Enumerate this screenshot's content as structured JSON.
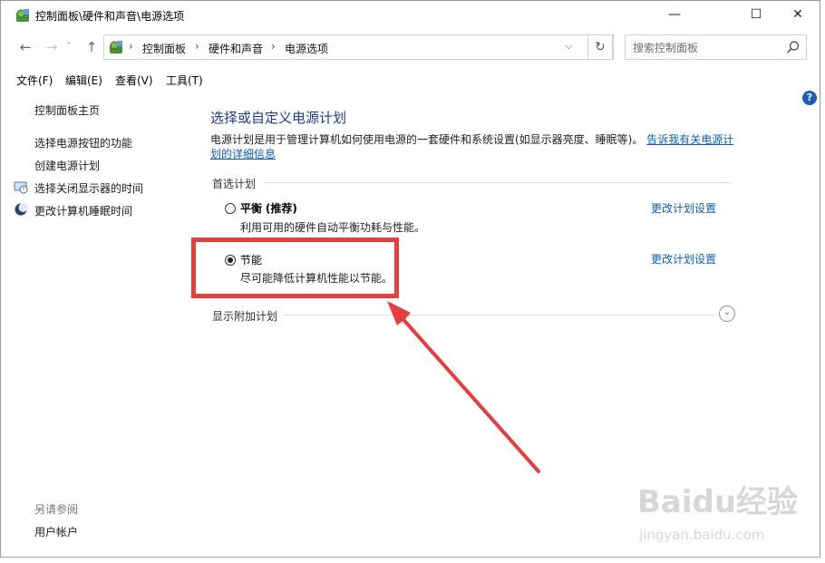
{
  "window": {
    "title": "控制面板\\硬件和声音\\电源选项",
    "buttons": {
      "minimize": "—",
      "maximize": "☐",
      "close": "✕"
    }
  },
  "nav": {
    "back": "←",
    "forward": "→",
    "recent": "˅",
    "up": "↑",
    "breadcrumb": [
      "控制面板",
      "硬件和声音",
      "电源选项"
    ],
    "separator": "›",
    "dropdown": "⌵",
    "refresh": "↻",
    "search_placeholder": "搜索控制面板"
  },
  "menu": [
    "文件(F)",
    "编辑(E)",
    "查看(V)",
    "工具(T)"
  ],
  "help": "?",
  "sidebar": {
    "home": "控制面板主页",
    "links": [
      "选择电源按钮的功能",
      "创建电源计划",
      "选择关闭显示器的时间",
      "更改计算机睡眠时间"
    ],
    "see_also_title": "另请参阅",
    "see_also": [
      "用户帐户"
    ]
  },
  "main": {
    "heading": "选择或自定义电源计划",
    "description": "电源计划是用于管理计算机如何使用电源的一套硬件和系统设置(如显示器亮度、睡眠等)。",
    "description_link": "告诉我有关电源计划的详细信息",
    "preferred_label": "首选计划",
    "plans": [
      {
        "name": "平衡",
        "tag": "(推荐)",
        "desc": "利用可用的硬件自动平衡功耗与性能。",
        "link": "更改计划设置",
        "selected": false
      },
      {
        "name": "节能",
        "tag": "",
        "desc": "尽可能降低计算机性能以节能。",
        "link": "更改计划设置",
        "selected": true
      }
    ],
    "show_more": "显示附加计划"
  },
  "icons": {
    "app": "control-panel-icon",
    "search": "search-icon",
    "monitor": "monitor-clock-icon",
    "sleep": "moon-icon"
  },
  "annotation_color": "#e53e3e",
  "watermark": {
    "brand": "Baidu经验",
    "url": "jingyan.baidu.com"
  }
}
